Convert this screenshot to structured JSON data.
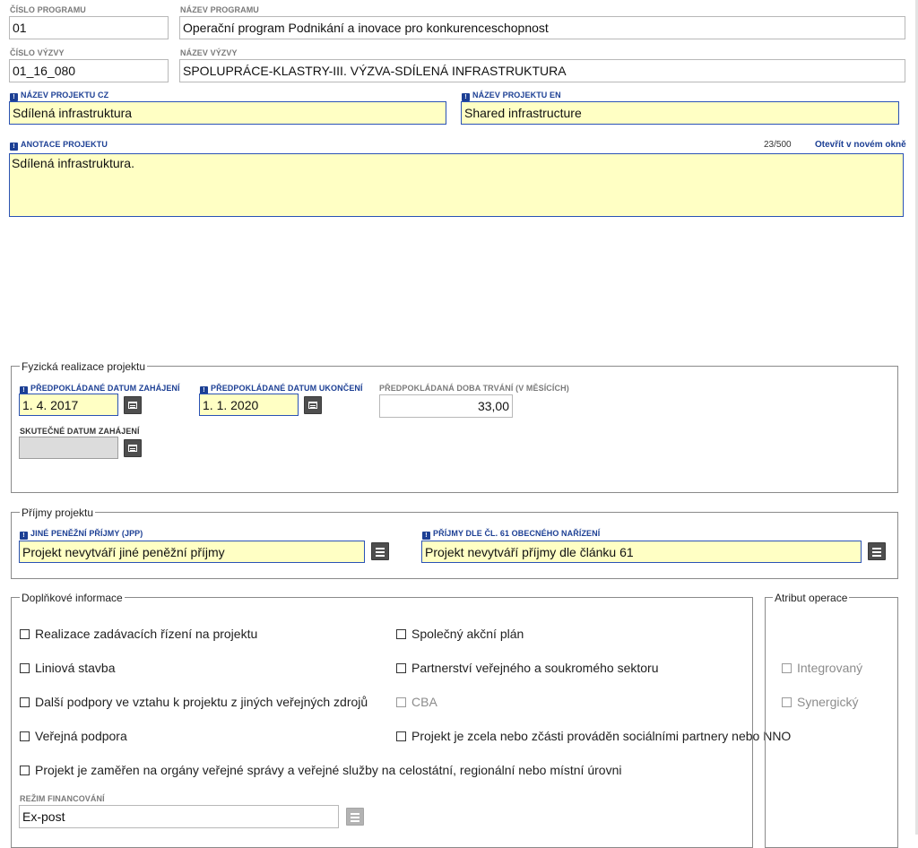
{
  "program": {
    "number_label": "ČÍSLO PROGRAMU",
    "number_value": "01",
    "name_label": "NÁZEV PROGRAMU",
    "name_value": "Operační program Podnikání a inovace pro konkurenceschopnost"
  },
  "call": {
    "number_label": "ČÍSLO VÝZVY",
    "number_value": "01_16_080",
    "name_label": "NÁZEV VÝZVY",
    "name_value": "SPOLUPRÁCE-KLASTRY-III. VÝZVA-SDÍLENÁ INFRASTRUKTURA"
  },
  "project": {
    "name_cz_label": "NÁZEV PROJEKTU CZ",
    "name_cz_value": "Sdílená infrastruktura",
    "name_en_label": "NÁZEV PROJEKTU EN",
    "name_en_value": "Shared infrastructure",
    "annotation_label": "ANOTACE PROJEKTU",
    "annotation_counter": "23/500",
    "annotation_link": "Otevřít v novém okně",
    "annotation_value": "Sdílená infrastruktura."
  },
  "physical": {
    "legend": "Fyzická realizace projektu",
    "start_label": "PŘEDPOKLÁDANÉ DATUM ZAHÁJENÍ",
    "start_value": "1. 4. 2017",
    "end_label": "PŘEDPOKLÁDANÉ DATUM UKONČENÍ",
    "end_value": "1. 1. 2020",
    "duration_label": "PŘEDPOKLÁDANÁ DOBA TRVÁNÍ (V MĚSÍCÍCH)",
    "duration_value": "33,00",
    "actual_start_label": "SKUTEČNÉ DATUM ZAHÁJENÍ",
    "actual_start_value": ""
  },
  "income": {
    "legend": "Příjmy projektu",
    "jpp_label": "JINÉ PENĚŽNÍ PŘÍJMY (JPP)",
    "jpp_value": "Projekt nevytváří jiné peněžní příjmy",
    "art61_label": "PŘÍJMY DLE ČL. 61 OBECNÉHO NAŘÍZENÍ",
    "art61_value": "Projekt nevytváří příjmy dle článku 61"
  },
  "additional": {
    "legend": "Doplňkové informace",
    "checkboxes_left": [
      "Realizace zadávacích řízení na projektu",
      "Liniová stavba",
      "Další podpory ve vztahu k projektu z jiných veřejných zdrojů",
      "Veřejná podpora",
      "Projekt je zaměřen na orgány veřejné správy a veřejné služby na celostátní, regionální nebo místní úrovni"
    ],
    "checkboxes_right": [
      "Společný akční plán",
      "Partnerství veřejného a soukromého sektoru",
      "CBA",
      "Projekt je zcela nebo zčásti prováděn sociálními partnery nebo NNO"
    ],
    "financing_label": "REŽIM FINANCOVÁNÍ",
    "financing_value": "Ex-post"
  },
  "operation": {
    "legend": "Atribut operace",
    "checkboxes": [
      "Integrovaný",
      "Synergický"
    ]
  }
}
